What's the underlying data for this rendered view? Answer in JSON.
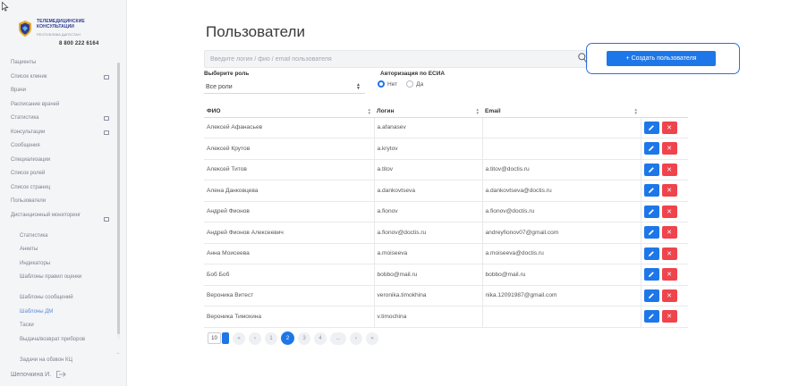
{
  "app": {
    "logo_lines": [
      "ТЕЛЕМЕДИЦИНСКИЕ",
      "КОНСУЛЬТАЦИИ"
    ],
    "logo_subtitle": "РЕСПУБЛИКА ДАГЕСТАН",
    "phone": "8 800 222 6164"
  },
  "sidebar": {
    "items": [
      {
        "label": "Пациенты",
        "folder": false,
        "sub": false
      },
      {
        "label": "Список клиник",
        "folder": true,
        "sub": false
      },
      {
        "label": "Врачи",
        "folder": false,
        "sub": false
      },
      {
        "label": "Расписание врачей",
        "folder": false,
        "sub": false
      },
      {
        "label": "Статистика",
        "folder": true,
        "sub": false
      },
      {
        "label": "Консультации",
        "folder": true,
        "sub": false
      },
      {
        "label": "Сообщения",
        "folder": false,
        "sub": false
      },
      {
        "label": "Специализации",
        "folder": false,
        "sub": false
      },
      {
        "label": "Список ролей",
        "folder": false,
        "sub": false
      },
      {
        "label": "Список страниц",
        "folder": false,
        "sub": false
      },
      {
        "label": "Пользователи",
        "folder": false,
        "sub": false
      },
      {
        "label": "Дистанционный мониторинг",
        "folder": true,
        "sub": false,
        "tall": true
      },
      {
        "label": "Статистика",
        "folder": false,
        "sub": true
      },
      {
        "label": "Анкеты",
        "folder": false,
        "sub": true
      },
      {
        "label": "Индикаторы",
        "folder": false,
        "sub": true
      },
      {
        "label": "Шаблоны правил оценки",
        "folder": false,
        "sub": true,
        "tall": true
      },
      {
        "label": "Шаблоны сообщений",
        "folder": false,
        "sub": true
      },
      {
        "label": "Шаблоны ДМ",
        "folder": false,
        "sub": true,
        "active": true
      },
      {
        "label": "Таски",
        "folder": false,
        "sub": true
      },
      {
        "label": "Выдача/возврат приборов",
        "folder": false,
        "sub": true,
        "tall": true
      },
      {
        "label": "Задачи на обзвон КЦ",
        "folder": false,
        "sub": true
      }
    ],
    "user_name": "Шепочкина И."
  },
  "main": {
    "title": "Пользователи",
    "search_placeholder": "Введите логин / фио / email пользователя",
    "create_label": "+ Создать пользователя",
    "role_label": "Выберите роль",
    "role_value": "Все роли",
    "esia_label": "Авторизация по ЕСИА",
    "esia_options": [
      {
        "label": "Нет",
        "checked": true
      },
      {
        "label": "Да",
        "checked": false
      }
    ]
  },
  "table": {
    "columns": [
      "ФИО",
      "Логин",
      "Email",
      ""
    ],
    "rows": [
      {
        "fio": "Алексей Афанасьев",
        "login": "a.afanasev",
        "email": ""
      },
      {
        "fio": "Алексей Крутов",
        "login": "a.krytov",
        "email": ""
      },
      {
        "fio": "Алексей Титов",
        "login": "a.titov",
        "email": "a.titov@doctis.ru"
      },
      {
        "fio": "Алена Данковцева",
        "login": "a.dankovtseva",
        "email": "a.dankovtseva@doctis.ru"
      },
      {
        "fio": "Андрей Фионов",
        "login": "a.fionov",
        "email": "a.fionov@doctis.ru"
      },
      {
        "fio": "Андрей Фионов Алексеевич",
        "login": "a.fionov@doctis.ru",
        "email": "andreyfionov07@gmail.com"
      },
      {
        "fio": "Анна Моисеева",
        "login": "a.moiseeva",
        "email": "a.moiseeva@doctis.ru"
      },
      {
        "fio": "Боб Боб",
        "login": "bobbo@mail.ru",
        "email": "bobbo@mail.ru"
      },
      {
        "fio": "Вероника Витест",
        "login": "veronika.timokhina",
        "email": "nika.12091987@gmail.com"
      },
      {
        "fio": "Вероника Тимохина",
        "login": "v.timochina",
        "email": ""
      }
    ]
  },
  "pagination": {
    "page_size": "10",
    "pages": [
      "«",
      "‹",
      "1",
      "2",
      "3",
      "4",
      "...",
      "›",
      "»"
    ],
    "current": "2"
  },
  "colors": {
    "primary": "#1e77e8",
    "danger": "#f0444d",
    "highlight": "#2f6fdc"
  }
}
